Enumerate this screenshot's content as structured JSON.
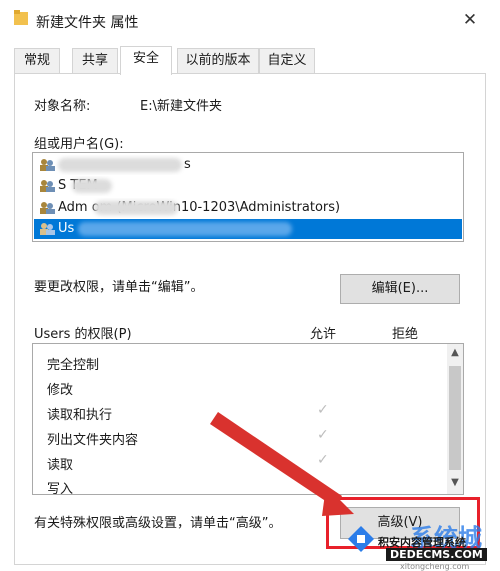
{
  "window": {
    "title": "新建文件夹 属性",
    "close_glyph": "✕"
  },
  "tabs": [
    {
      "label": "常规"
    },
    {
      "label": "共享"
    },
    {
      "label": "安全"
    },
    {
      "label": "以前的版本"
    },
    {
      "label": "自定义"
    }
  ],
  "object_name": {
    "label": "对象名称:",
    "value": "E:\\新建文件夹"
  },
  "group_list": {
    "label": "组或用户名(G):",
    "items": [
      {
        "text": "s",
        "selected": false
      },
      {
        "text": "S      TEM",
        "selected": false
      },
      {
        "text": "Adm            om (MicroWin10-1203\\Administrators)",
        "selected": false
      },
      {
        "text": "Us",
        "selected": true
      }
    ]
  },
  "edit_hint": "要更改权限，请单击“编辑”。",
  "edit_button": "编辑(E)...",
  "permissions": {
    "title": "Users 的权限(P)",
    "allow_header": "允许",
    "deny_header": "拒绝",
    "rows": [
      {
        "name": "完全控制",
        "allow": false
      },
      {
        "name": "修改",
        "allow": false
      },
      {
        "name": "读取和执行",
        "allow": true
      },
      {
        "name": "列出文件夹内容",
        "allow": true
      },
      {
        "name": "读取",
        "allow": true
      },
      {
        "name": "写入",
        "allow": false
      }
    ]
  },
  "advanced_hint": "有关特殊权限或高级设置，请单击“高级”。",
  "advanced_button": "高级(V)",
  "watermark": {
    "line1": "系统城",
    "line2": "积安内容管理系统",
    "line3": "DEDECMS.COM",
    "line4": "xitongcheng.com"
  },
  "colors": {
    "selection": "#0078d7",
    "highlight": "#e8202a",
    "arrow": "#d9322e"
  }
}
